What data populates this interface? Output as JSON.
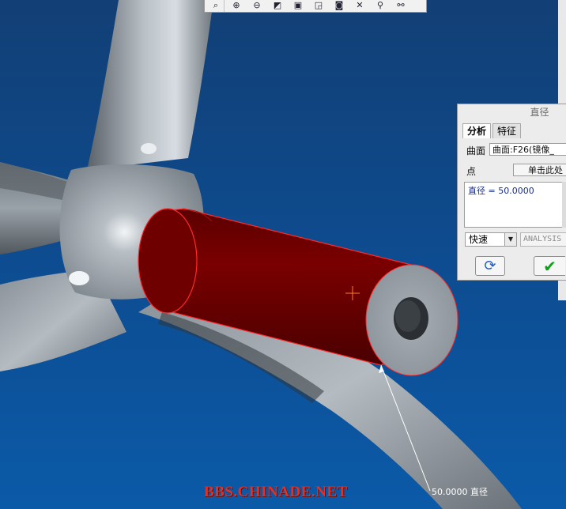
{
  "toolbar": {
    "buttons": [
      {
        "name": "refit-icon",
        "glyph": "⌕"
      },
      {
        "name": "zoom-in-icon",
        "glyph": "⊕"
      },
      {
        "name": "zoom-out-icon",
        "glyph": "⊖"
      },
      {
        "name": "repaint-icon",
        "glyph": "◩"
      },
      {
        "name": "view-orient-icon",
        "glyph": "▣"
      },
      {
        "name": "saved-views-icon",
        "glyph": "◲"
      },
      {
        "name": "camera-icon",
        "glyph": "◙"
      },
      {
        "name": "datum-display-icon",
        "glyph": "✕"
      },
      {
        "name": "axis-display-icon",
        "glyph": "⚲"
      },
      {
        "name": "point-display-icon",
        "glyph": "⚯"
      }
    ]
  },
  "dialog": {
    "title": "直径",
    "tabs": [
      {
        "label": "分析",
        "active": true
      },
      {
        "label": "特征",
        "active": false
      }
    ],
    "surface_label": "曲面",
    "surface_value": "曲面:F26(镜像_",
    "point_label": "点",
    "point_value": "单击此处",
    "result": "直径 = 50.0000",
    "mode_value": "快速",
    "analysis_name": "ANALYSIS"
  },
  "viewport": {
    "dimension_label": "50.0000 直径"
  },
  "watermark": "BBS.CHINADE.NET",
  "colors": {
    "background_top": "#123f75",
    "background_bottom": "#0b5aa8",
    "selected_surface": "#6d0000",
    "highlight_edge": "#ff2a2a",
    "frame_gray": "#8f979e",
    "confirm_green": "#139d1c"
  }
}
